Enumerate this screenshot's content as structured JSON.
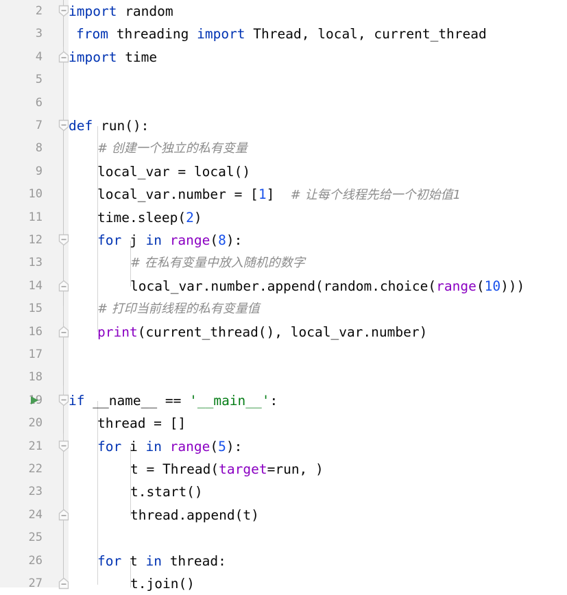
{
  "editor": {
    "app": "python-code-editor",
    "language": "Python",
    "theme_background": "#ffffff",
    "gutter_background": "#f2f2f2",
    "first_visible_line": 2,
    "last_visible_line": 27,
    "colors": {
      "keyword": "#0033B3",
      "number": "#1750EB",
      "string": "#067D17",
      "builtin": "#8A00C2",
      "keyword_argument": "#8A00C2",
      "comment": "#8C8C8C",
      "plain_text": "#080808",
      "line_number": "#999999",
      "run_arrow": "#499C54",
      "fold_marker": "#c6c6c6",
      "indent_guide": "#d4d4d4"
    }
  },
  "gutter": {
    "run_arrow_line": 19,
    "run_arrow_icon": "play-triangle-icon",
    "fold_markers": [
      {
        "line": 2,
        "type": "fold-start"
      },
      {
        "line": 4,
        "type": "fold-end"
      },
      {
        "line": 7,
        "type": "fold-start"
      },
      {
        "line": 12,
        "type": "fold-start"
      },
      {
        "line": 14,
        "type": "fold-end"
      },
      {
        "line": 16,
        "type": "fold-end"
      },
      {
        "line": 19,
        "type": "fold-start"
      },
      {
        "line": 21,
        "type": "fold-start"
      },
      {
        "line": 24,
        "type": "fold-end"
      },
      {
        "line": 27,
        "type": "fold-end"
      }
    ]
  },
  "lines": [
    {
      "n": 2,
      "text": "import random"
    },
    {
      "n": 3,
      "text": "from threading import Thread, local, current_thread"
    },
    {
      "n": 4,
      "text": "import time"
    },
    {
      "n": 5,
      "text": ""
    },
    {
      "n": 6,
      "text": ""
    },
    {
      "n": 7,
      "text": "def run():"
    },
    {
      "n": 8,
      "text": "    # 创建一个独立的私有变量"
    },
    {
      "n": 9,
      "text": "    local_var = local()"
    },
    {
      "n": 10,
      "text": "    local_var.number = [1]  # 让每个线程先给一个初始值1"
    },
    {
      "n": 11,
      "text": "    time.sleep(2)"
    },
    {
      "n": 12,
      "text": "    for j in range(8):"
    },
    {
      "n": 13,
      "text": "        # 在私有变量中放入随机的数字"
    },
    {
      "n": 14,
      "text": "        local_var.number.append(random.choice(range(10)))"
    },
    {
      "n": 15,
      "text": "    # 打印当前线程的私有变量值"
    },
    {
      "n": 16,
      "text": "    print(current_thread(), local_var.number)"
    },
    {
      "n": 17,
      "text": ""
    },
    {
      "n": 18,
      "text": ""
    },
    {
      "n": 19,
      "text": "if __name__ == '__main__':"
    },
    {
      "n": 20,
      "text": "    thread = []"
    },
    {
      "n": 21,
      "text": "    for i in range(5):"
    },
    {
      "n": 22,
      "text": "        t = Thread(target=run, )"
    },
    {
      "n": 23,
      "text": "        t.start()"
    },
    {
      "n": 24,
      "text": "        thread.append(t)"
    },
    {
      "n": 25,
      "text": ""
    },
    {
      "n": 26,
      "text": "    for t in thread:"
    },
    {
      "n": 27,
      "text": "        t.join()"
    }
  ],
  "line_numbers": {
    "l2": "2",
    "l3": "3",
    "l4": "4",
    "l5": "5",
    "l6": "6",
    "l7": "7",
    "l8": "8",
    "l9": "9",
    "l10": "10",
    "l11": "11",
    "l12": "12",
    "l13": "13",
    "l14": "14",
    "l15": "15",
    "l16": "16",
    "l17": "17",
    "l18": "18",
    "l19": "19",
    "l20": "20",
    "l21": "21",
    "l22": "22",
    "l23": "23",
    "l24": "24",
    "l25": "25",
    "l26": "26",
    "l27": "27"
  },
  "tokens": {
    "l2": {
      "kw_import": "import",
      "mod": " random"
    },
    "l3": {
      "kw_from": "from",
      "mod": " threading ",
      "kw_import": "import",
      "names": " Thread, local, current_thread"
    },
    "l4": {
      "kw_import": "import",
      "mod": " time"
    },
    "l7": {
      "kw_def": "def",
      "name": " run():"
    },
    "l8": {
      "comment": "# 创建一个独立的私有变量"
    },
    "l9": {
      "code": "local_var = local()"
    },
    "l10": {
      "pre": "local_var.number = [",
      "num": "1",
      "post": "]  ",
      "comment": "# 让每个线程先给一个初始值1"
    },
    "l11": {
      "pre": "time.sleep(",
      "num": "2",
      "post": ")"
    },
    "l12": {
      "kw_for": "for",
      "var": " j ",
      "kw_in": "in",
      "fn": " range",
      "open": "(",
      "num": "8",
      "close": "):"
    },
    "l13": {
      "comment": "# 在私有变量中放入随机的数字"
    },
    "l14": {
      "pre": "local_var.number.append(random.choice(",
      "fn": "range",
      "open": "(",
      "num": "10",
      "close": ")))"
    },
    "l15": {
      "comment": "# 打印当前线程的私有变量值"
    },
    "l16": {
      "fn": "print",
      "post": "(current_thread(), local_var.number)"
    },
    "l19": {
      "kw_if": "if",
      "mid": " __name__ == ",
      "str": "'__main__'",
      "end": ":"
    },
    "l20": {
      "code": "thread = []"
    },
    "l21": {
      "kw_for": "for",
      "var": " i ",
      "kw_in": "in",
      "fn": " range",
      "open": "(",
      "num": "5",
      "close": "):"
    },
    "l22": {
      "pre": "t = Thread(",
      "kwarg": "target",
      "post": "=run, )"
    },
    "l23": {
      "code": "t.start()"
    },
    "l24": {
      "code": "thread.append(t)"
    },
    "l26": {
      "kw_for": "for",
      "var": " t ",
      "kw_in": "in",
      "rest": " thread:"
    },
    "l27": {
      "code": "t.join()"
    }
  }
}
